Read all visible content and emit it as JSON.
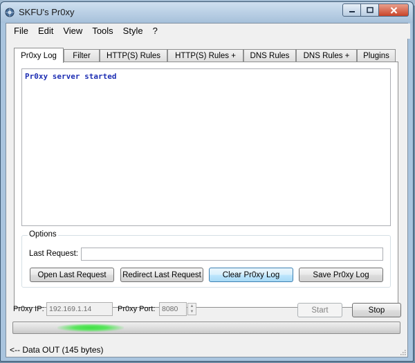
{
  "window": {
    "title": "SKFU's Pr0xy"
  },
  "menu": [
    "File",
    "Edit",
    "View",
    "Tools",
    "Style",
    "?"
  ],
  "tabs": [
    {
      "label": "Pr0xy Log",
      "active": true
    },
    {
      "label": "Filter",
      "active": false
    },
    {
      "label": "HTTP(S) Rules",
      "active": false
    },
    {
      "label": "HTTP(S) Rules +",
      "active": false
    },
    {
      "label": "DNS Rules",
      "active": false
    },
    {
      "label": "DNS Rules +",
      "active": false
    },
    {
      "label": "Plugins",
      "active": false
    }
  ],
  "log": {
    "lines": [
      "Pr0xy server started"
    ],
    "color": "#1d2eb3"
  },
  "options": {
    "title": "Options",
    "last_request_label": "Last Request:",
    "last_request_value": "",
    "buttons": {
      "open_last": "Open Last Request",
      "redirect_last": "Redirect Last Request",
      "clear_log": "Clear Pr0xy Log",
      "save_log": "Save Pr0xy Log"
    }
  },
  "server": {
    "ip_label": "Pr0xy IP:",
    "ip_value": "192.169.1.14",
    "port_label": "Pr0xy Port:",
    "port_value": "8080",
    "start_label": "Start",
    "stop_label": "Stop"
  },
  "activity": {
    "level": 0.2
  },
  "status": {
    "text": "<-- Data OUT (145 bytes)"
  },
  "icons": {
    "app": "globe-gear-icon",
    "minimize": "minimize-icon",
    "maximize": "maximize-icon",
    "close": "close-icon",
    "spin_up": "chevron-up-icon",
    "spin_down": "chevron-down-icon",
    "grip": "resize-grip-icon"
  }
}
